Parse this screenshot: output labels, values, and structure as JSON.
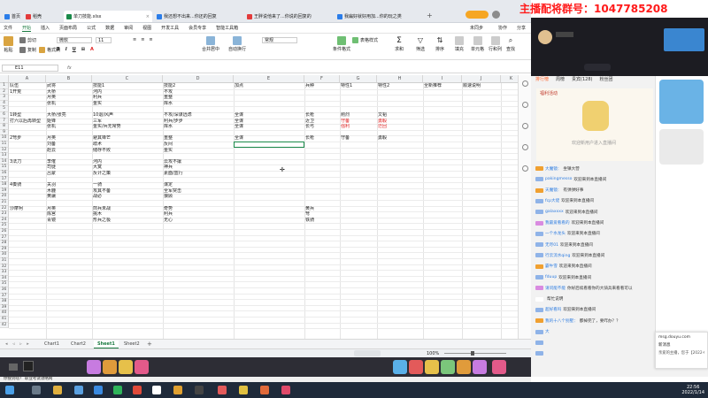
{
  "tabs": [
    {
      "label": "首页",
      "color": "#2b7de9"
    },
    {
      "label": "稻壳",
      "color": "#e33b3b"
    },
    {
      "label": "单刀技能.xlsx",
      "color": "#1a8a4a",
      "active": true
    },
    {
      "label": "我还想不出来...你还的回复",
      "color": "#2b7de9"
    },
    {
      "label": "王胖说他来了...你说的回复的",
      "color": "#e33b3b"
    },
    {
      "label": "我扁好就好用加...你的玩之类",
      "color": "#2b7de9"
    }
  ],
  "stream_banner": "主播配将群号：1047785208",
  "menu": [
    "文件",
    "开始",
    "插入",
    "页面布局",
    "公式",
    "数据",
    "审阅",
    "视图",
    "开发工具",
    "会员专享",
    "智能工具箱"
  ],
  "menu_selected": "开始",
  "ribbon": {
    "paste": "粘贴",
    "cut": "剪切",
    "copy": "复制",
    "format_painter": "格式刷",
    "font_name": "微软",
    "font_size": "11",
    "merge": "合并居中",
    "wrap": "自动换行",
    "currency": "常规",
    "cond_format": "条件格式",
    "table_style": "表格样式",
    "sum": "求和",
    "filter": "筛选",
    "sort": "排序",
    "fill": "填充",
    "cell": "单元格",
    "row_col": "行和列",
    "worksheet": "工作表",
    "freeze": "冻结窗格",
    "find": "查找",
    "share": "分享",
    "sync": "未同步",
    "collab": "协作"
  },
  "formula_bar": {
    "name_box": "E11",
    "fx": "fx",
    "content": ""
  },
  "columns": [
    {
      "label": "A",
      "header": "队伍"
    },
    {
      "label": "B",
      "header": "武将"
    },
    {
      "label": "C",
      "header": "技能1"
    },
    {
      "label": "D",
      "header": "技能2"
    },
    {
      "label": "E",
      "header": "加点"
    },
    {
      "label": "F",
      "header": "兵种"
    },
    {
      "label": "G",
      "header": "特性1"
    },
    {
      "label": "H",
      "header": "特性2"
    },
    {
      "label": "I",
      "header": "战术推荐"
    },
    {
      "label": "J",
      "header": "顺序说明"
    },
    {
      "label": "K",
      "header": ""
    }
  ],
  "rows": [
    {
      "n": "1",
      "cells": [
        "队伍",
        "武将",
        "技能1",
        "技能2",
        "加点",
        "兵种",
        "特性1",
        "特性2",
        "全新推荐",
        "顺速说明"
      ]
    },
    {
      "n": "2",
      "cells": [
        "1开荒",
        "大桥",
        "河内",
        "不攻",
        "",
        "",
        "",
        "",
        "",
        ""
      ]
    },
    {
      "n": "3",
      "cells": [
        "",
        "月英",
        "利兵",
        "重整",
        "",
        "",
        "",
        "",
        "",
        ""
      ]
    },
    {
      "n": "4",
      "cells": [
        "",
        "张机",
        "金实",
        "库水",
        "",
        "",
        "",
        "",
        "",
        ""
      ]
    },
    {
      "n": "5",
      "cells": [
        "",
        "",
        "",
        "",
        "",
        "",
        "",
        "",
        "",
        ""
      ]
    },
    {
      "n": "6",
      "cells": [
        "1转型",
        "大桥/张亮",
        "10退/风声",
        "不攻/深谋远虑",
        "全谋",
        "长枪",
        "刚烈",
        "文韬",
        "",
        ""
      ]
    },
    {
      "n": "7",
      "cells": [
        "打六以后再转型",
        "姬锋",
        "三军",
        "利兵/步步",
        "全谋",
        "近卫",
        "守备",
        "勇毅",
        "",
        ""
      ]
    },
    {
      "n": "8",
      "cells": [
        "",
        "张机",
        "金实/兵无常势",
        "库水",
        "全谋",
        "长弓",
        "强利",
        "迁回",
        "",
        ""
      ]
    },
    {
      "n": "9",
      "cells": [
        "",
        "",
        "",
        "",
        "",
        "",
        "",
        "",
        "",
        ""
      ]
    },
    {
      "n": "10",
      "cells": [
        "2弩步",
        "月英",
        "避其锋芒",
        "重整",
        "全谋",
        "长枪",
        "守备",
        "勇毅",
        "",
        ""
      ]
    },
    {
      "n": "11",
      "cells": [
        "",
        "刘备",
        "歧术",
        "反间",
        "",
        "",
        "",
        "",
        "",
        ""
      ]
    },
    {
      "n": "12",
      "cells": [
        "",
        "赵云",
        "储存不败",
        "金实",
        "",
        "",
        "",
        "",
        "",
        ""
      ]
    },
    {
      "n": "13",
      "cells": [
        "",
        "",
        "",
        "",
        "",
        "",
        "",
        "",
        "",
        ""
      ]
    },
    {
      "n": "14",
      "cells": [
        "3法刀",
        "李傕",
        "河内",
        "云攻不攘",
        "",
        "",
        "",
        "",
        "",
        ""
      ]
    },
    {
      "n": "15",
      "cells": [
        "",
        "司徒",
        "大寞",
        "神兵",
        "",
        "",
        "",
        "",
        "",
        ""
      ]
    },
    {
      "n": "16",
      "cells": [
        "",
        "吕蒙",
        "反计之策",
        "素面/蓝行",
        "",
        "",
        "",
        "",
        "",
        ""
      ]
    },
    {
      "n": "17",
      "cells": [
        "",
        "",
        "",
        "",
        "",
        "",
        "",
        "",
        "",
        ""
      ]
    },
    {
      "n": "18",
      "cells": [
        "4奏骑",
        "关羽",
        "一骑",
        "谋定",
        "",
        "",
        "",
        "",
        "",
        ""
      ]
    },
    {
      "n": "19",
      "cells": [
        "",
        "木鹿",
        "攻其不备",
        "全军突击",
        "",
        "",
        "",
        "",
        "",
        ""
      ]
    },
    {
      "n": "20",
      "cells": [
        "",
        "黄骧",
        "战必",
        "狼顾",
        "",
        "",
        "",
        "",
        "",
        ""
      ]
    },
    {
      "n": "21",
      "cells": [
        "",
        "",
        "",
        "",
        "",
        "",
        "",
        "",
        "",
        ""
      ]
    },
    {
      "n": "22",
      "cells": [
        "沙摩柯",
        "月英",
        "煎兵未战",
        "奇势",
        "",
        "黄兵",
        "",
        "",
        "",
        ""
      ]
    },
    {
      "n": "23",
      "cells": [
        "",
        "陈宫",
        "挑木",
        "利兵",
        "",
        "弩",
        "",
        "",
        "",
        ""
      ]
    },
    {
      "n": "24",
      "cells": [
        "",
        "青镜",
        "形兵之极",
        "无心",
        "",
        "铁骑",
        "",
        "",
        "",
        ""
      ]
    },
    {
      "n": "25",
      "cells": [
        "",
        "",
        "",
        "",
        "",
        "",
        "",
        "",
        "",
        ""
      ]
    },
    {
      "n": "26",
      "cells": [
        "",
        "",
        "",
        "",
        "",
        "",
        "",
        "",
        "",
        ""
      ]
    },
    {
      "n": "27",
      "cells": [
        "",
        "",
        "",
        "",
        "",
        "",
        "",
        "",
        "",
        ""
      ]
    },
    {
      "n": "28",
      "cells": [
        "",
        "",
        "",
        "",
        "",
        "",
        "",
        "",
        "",
        ""
      ]
    },
    {
      "n": "29",
      "cells": [
        "",
        "",
        "",
        "",
        "",
        "",
        "",
        "",
        "",
        ""
      ]
    },
    {
      "n": "30",
      "cells": [
        "",
        "",
        "",
        "",
        "",
        "",
        "",
        "",
        "",
        ""
      ]
    },
    {
      "n": "31",
      "cells": [
        "",
        "",
        "",
        "",
        "",
        "",
        "",
        "",
        "",
        ""
      ]
    },
    {
      "n": "32",
      "cells": [
        "",
        "",
        "",
        "",
        "",
        "",
        "",
        "",
        "",
        ""
      ]
    },
    {
      "n": "33",
      "cells": [
        "",
        "",
        "",
        "",
        "",
        "",
        "",
        "",
        "",
        ""
      ]
    },
    {
      "n": "34",
      "cells": [
        "",
        "",
        "",
        "",
        "",
        "",
        "",
        "",
        "",
        ""
      ]
    },
    {
      "n": "35",
      "cells": [
        "",
        "",
        "",
        "",
        "",
        "",
        "",
        "",
        "",
        ""
      ]
    },
    {
      "n": "36",
      "cells": [
        "",
        "",
        "",
        "",
        "",
        "",
        "",
        "",
        "",
        ""
      ]
    },
    {
      "n": "37",
      "cells": [
        "",
        "",
        "",
        "",
        "",
        "",
        "",
        "",
        "",
        ""
      ]
    },
    {
      "n": "38",
      "cells": [
        "",
        "",
        "",
        "",
        "",
        "",
        "",
        "",
        "",
        ""
      ]
    },
    {
      "n": "39",
      "cells": [
        "",
        "",
        "",
        "",
        "",
        "",
        "",
        "",
        "",
        ""
      ]
    },
    {
      "n": "40",
      "cells": [
        "",
        "",
        "",
        "",
        "",
        "",
        "",
        "",
        "",
        ""
      ]
    },
    {
      "n": "41",
      "cells": [
        "",
        "",
        "",
        "",
        "",
        "",
        "",
        "",
        "",
        ""
      ]
    },
    {
      "n": "42",
      "cells": [
        "",
        "",
        "",
        "",
        "",
        "",
        "",
        "",
        "",
        ""
      ]
    }
  ],
  "red_cells": [
    "6-6",
    "6-7",
    "7-6",
    "7-7",
    "8-6",
    "8-7",
    "10-7"
  ],
  "sheet_tabs": [
    "Chart1",
    "Chart2",
    "Sheet1",
    "Sheet2"
  ],
  "active_sheet": "Sheet1",
  "zoom": "100%",
  "side": {
    "tabs": [
      "排行榜",
      "周榜",
      "贵宾(128)",
      "粉丝团"
    ],
    "active_tab": "排行榜",
    "event_label": "福利活动",
    "welcome": "欢迎新用户进入直播间",
    "chat": [
      {
        "user": "大魔镜：",
        "text": "坐镇大营",
        "badge": "#f0a030"
      },
      {
        "user": "pakingmesso",
        "text": "欢迎来到本直播间",
        "badge": "#8fb3e8"
      },
      {
        "user": "天魔镜：",
        "text": "有弹弹好事",
        "badge": "#f0a030"
      },
      {
        "user": "fcp大佬",
        "text": "欢迎来到本直播间",
        "badge": "#8fb3e8"
      },
      {
        "user": "galaxxxx",
        "text": "欢迎来到本直播间",
        "badge": "#8fb3e8"
      },
      {
        "user": "我最爱看看的",
        "text": "欢迎来到本直播间",
        "badge": "#d98be0"
      },
      {
        "user": "一个水龙头",
        "text": "欢迎来到本直播间",
        "badge": "#8fb3e8"
      },
      {
        "user": "无尽01",
        "text": "欢迎来到本直播间",
        "badge": "#8fb3e8"
      },
      {
        "user": "行云流水qing",
        "text": "欢迎来到本直播间",
        "badge": "#8fb3e8"
      },
      {
        "user": "霸牛雪",
        "text": "欢迎来到本直播间",
        "badge": "#f0a030"
      },
      {
        "user": "fduup",
        "text": "欢迎来到本直播间",
        "badge": "#8fb3e8"
      },
      {
        "user": "请问能不能",
        "text": "你好后续看看你的大骑兵来看看可以",
        "badge": "#d98be0"
      },
      {
        "user": "",
        "text": "帮忙说明",
        "badge": "#ffffff"
      },
      {
        "user": "超好看吗",
        "text": "欢迎来到本直播间",
        "badge": "#8fb3e8"
      },
      {
        "user": "我的十八个别墅：",
        "text": "都掉完了，要咋办？？",
        "badge": "#f0a030"
      },
      {
        "user": "大",
        "text": "",
        "badge": "#8fb3e8"
      },
      {
        "user": "",
        "text": "",
        "badge": "#8fb3e8"
      },
      {
        "user": "",
        "text": "",
        "badge": "#8fb3e8"
      }
    ],
    "notif_title": "msg.douyu.com",
    "notif_app": "新消息",
    "notif_body": "亲爱的主播，您于【2022-01-1..."
  },
  "browser_status": "你搜到啥？ 职业考试攻略网",
  "clock_time": "22:56",
  "clock_date": "2022/1/14",
  "colors": {
    "accent": "#1a7a40",
    "red": "#e02020",
    "banner": "#ff1a1a"
  }
}
